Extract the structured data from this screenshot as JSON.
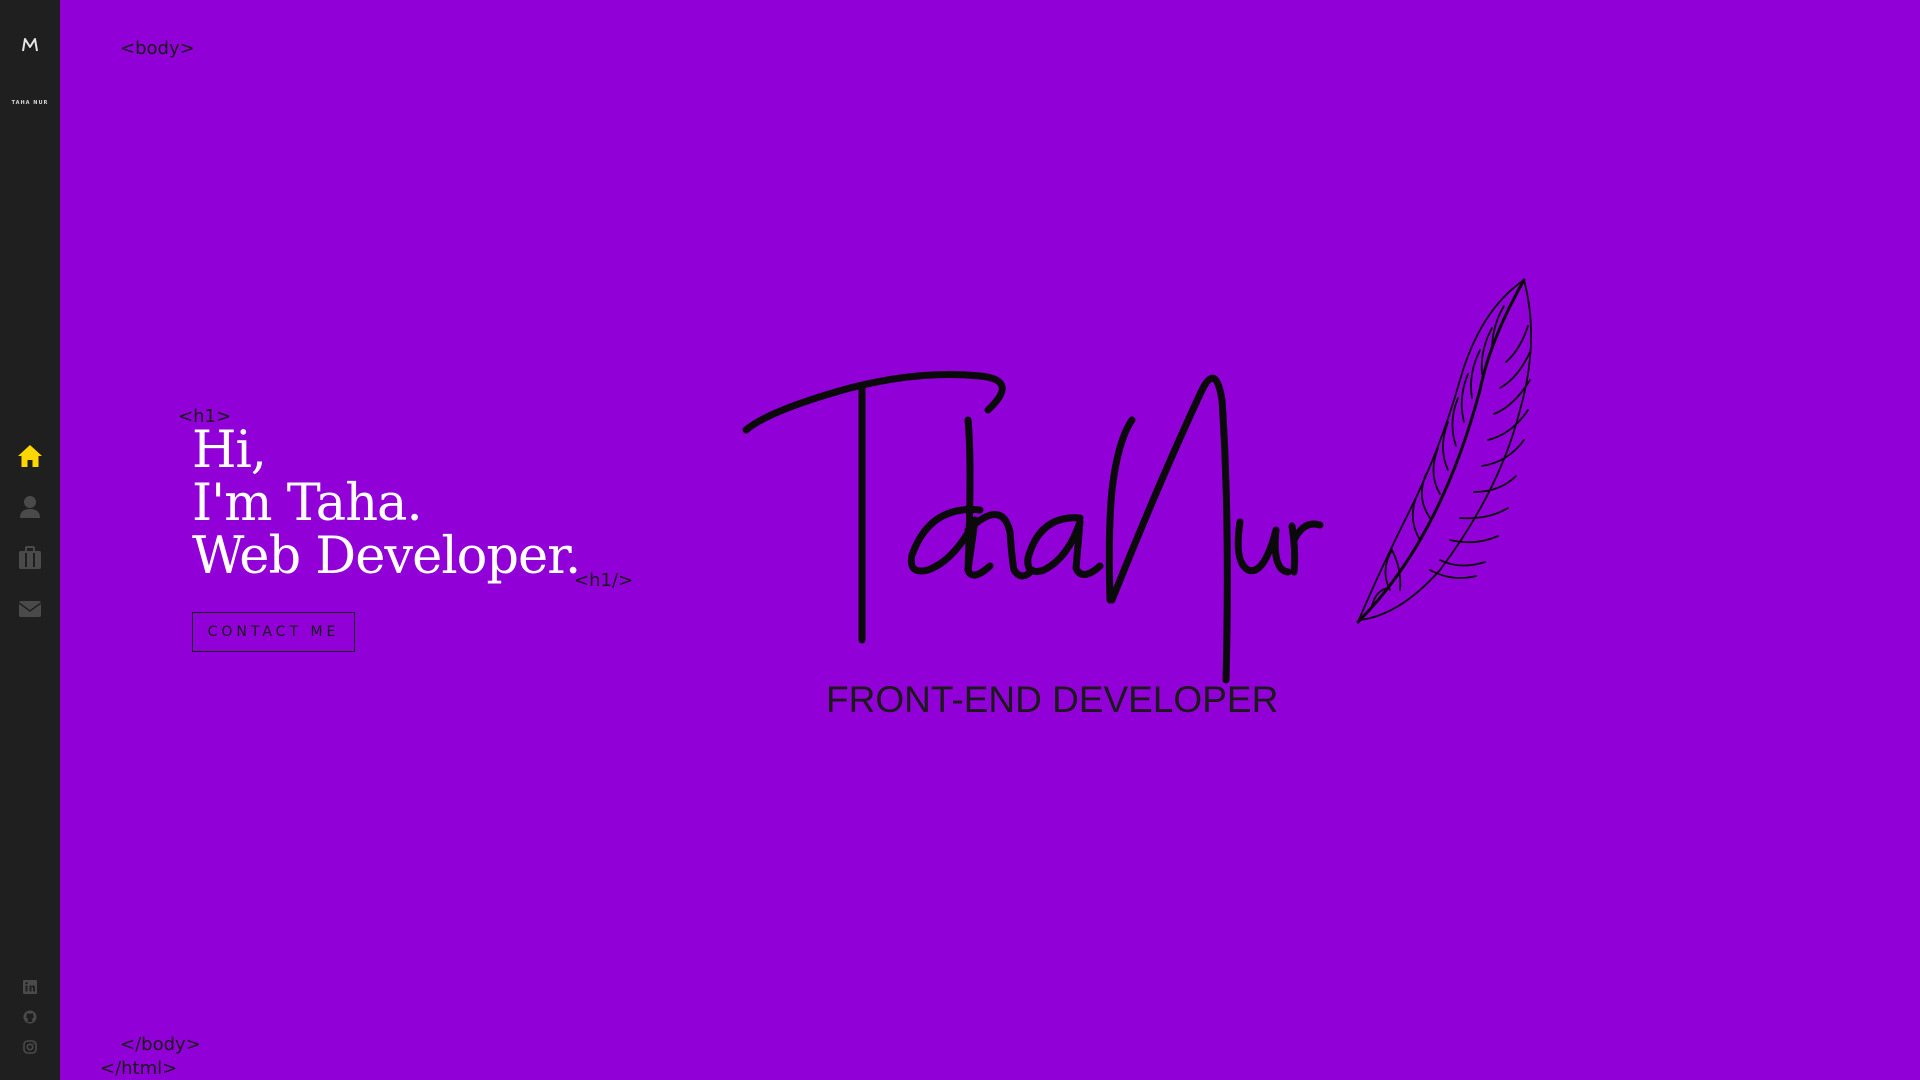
{
  "sidebar": {
    "logo_letter": "M",
    "logo_subtitle": "TAHA NUR",
    "nav_items": [
      {
        "name": "home",
        "icon": "home-icon",
        "active": true
      },
      {
        "name": "about",
        "icon": "user-icon",
        "active": false
      },
      {
        "name": "portfolio",
        "icon": "briefcase-icon",
        "active": false
      },
      {
        "name": "contact",
        "icon": "envelope-icon",
        "active": false
      }
    ],
    "social_links": [
      {
        "name": "linkedin",
        "icon": "linkedin-icon"
      },
      {
        "name": "github",
        "icon": "github-icon"
      },
      {
        "name": "instagram",
        "icon": "instagram-icon"
      }
    ]
  },
  "tags": {
    "body_open": "<body>",
    "h1_open": "<h1>",
    "h1_close": "<h1/>",
    "body_close": "</body>",
    "html_close": "</html>"
  },
  "hero": {
    "line1": "Hi,",
    "line2": "I'm Taha.",
    "line3": "Web Developer.",
    "cta_label": "CONTACT ME"
  },
  "signature": {
    "name": "Taha Nur",
    "tagline": "FRONT-END DEVELOPER"
  },
  "colors": {
    "background": "#9100d7",
    "sidebar": "#1f1f1f",
    "active_icon": "#ffd700",
    "inactive_icon": "#4a4a4a",
    "headline": "#ffffff",
    "ink": "#1a1a1a"
  }
}
